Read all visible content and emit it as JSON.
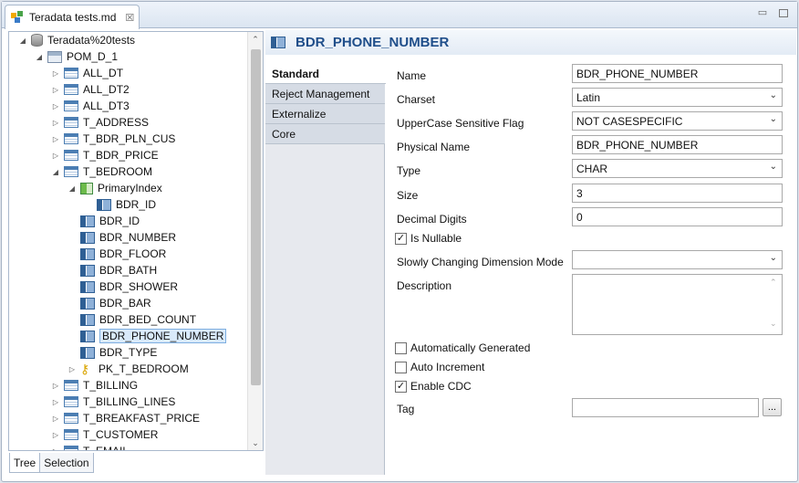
{
  "editor_tab": {
    "title": "Teradata tests.md",
    "close": "☒"
  },
  "tree": {
    "items": [
      {
        "label": "Teradata%20tests",
        "icon": "database-icon",
        "expanded": true,
        "depth": 0
      },
      {
        "label": "POM_D_1",
        "icon": "schema-icon",
        "expanded": true,
        "depth": 1
      },
      {
        "label": "ALL_DT",
        "icon": "table-icon",
        "depth": 2
      },
      {
        "label": "ALL_DT2",
        "icon": "table-icon",
        "depth": 2
      },
      {
        "label": "ALL_DT3",
        "icon": "table-icon",
        "depth": 2
      },
      {
        "label": "T_ADDRESS",
        "icon": "table-icon",
        "depth": 2
      },
      {
        "label": "T_BDR_PLN_CUS",
        "icon": "table-icon",
        "depth": 2
      },
      {
        "label": "T_BDR_PRICE",
        "icon": "table-icon",
        "depth": 2
      },
      {
        "label": "T_BEDROOM",
        "icon": "table-icon",
        "expanded": true,
        "depth": 2
      },
      {
        "label": "PrimaryIndex",
        "icon": "index-icon",
        "expanded": true,
        "depth": 3
      },
      {
        "label": "BDR_ID",
        "icon": "column-icon",
        "depth": 4
      },
      {
        "label": "BDR_ID",
        "icon": "column-icon",
        "depth": 3
      },
      {
        "label": "BDR_NUMBER",
        "icon": "column-icon",
        "depth": 3
      },
      {
        "label": "BDR_FLOOR",
        "icon": "column-icon",
        "depth": 3
      },
      {
        "label": "BDR_BATH",
        "icon": "column-icon",
        "depth": 3
      },
      {
        "label": "BDR_SHOWER",
        "icon": "column-icon",
        "depth": 3
      },
      {
        "label": "BDR_BAR",
        "icon": "column-icon",
        "depth": 3
      },
      {
        "label": "BDR_BED_COUNT",
        "icon": "column-icon",
        "depth": 3
      },
      {
        "label": "BDR_PHONE_NUMBER",
        "icon": "column-icon",
        "depth": 3,
        "selected": true
      },
      {
        "label": "BDR_TYPE",
        "icon": "column-icon",
        "depth": 3
      },
      {
        "label": "PK_T_BEDROOM",
        "icon": "key-icon",
        "depth": 3
      },
      {
        "label": "T_BILLING",
        "icon": "table-icon",
        "depth": 2
      },
      {
        "label": "T_BILLING_LINES",
        "icon": "table-icon",
        "depth": 2
      },
      {
        "label": "T_BREAKFAST_PRICE",
        "icon": "table-icon",
        "depth": 2
      },
      {
        "label": "T_CUSTOMER",
        "icon": "table-icon",
        "depth": 2
      },
      {
        "label": "T_EMAIL",
        "icon": "table-icon",
        "depth": 2
      }
    ]
  },
  "bottom_tabs": {
    "tree": "Tree",
    "selection": "Selection"
  },
  "editor": {
    "title": "BDR_PHONE_NUMBER",
    "tabs": [
      {
        "label": "Standard",
        "active": true
      },
      {
        "label": "Reject Management"
      },
      {
        "label": "Externalize"
      },
      {
        "label": "Core"
      }
    ],
    "fields": {
      "name_label": "Name",
      "name_value": "BDR_PHONE_NUMBER",
      "charset_label": "Charset",
      "charset_value": "Latin",
      "uppercase_label": "UpperCase Sensitive Flag",
      "uppercase_value": "NOT CASESPECIFIC",
      "physical_label": "Physical Name",
      "physical_value": "BDR_PHONE_NUMBER",
      "type_label": "Type",
      "type_value": "CHAR",
      "size_label": "Size",
      "size_value": "3",
      "decimal_label": "Decimal Digits",
      "decimal_value": "0",
      "nullable_label": "Is Nullable",
      "nullable_checked": true,
      "scd_label": "Slowly Changing Dimension Mode",
      "scd_value": "",
      "description_label": "Description",
      "description_value": "",
      "autogen_label": "Automatically Generated",
      "autogen_checked": false,
      "autoinc_label": "Auto Increment",
      "autoinc_checked": false,
      "cdc_label": "Enable CDC",
      "cdc_checked": true,
      "tag_label": "Tag",
      "tag_value": "",
      "browse_label": "..."
    }
  }
}
